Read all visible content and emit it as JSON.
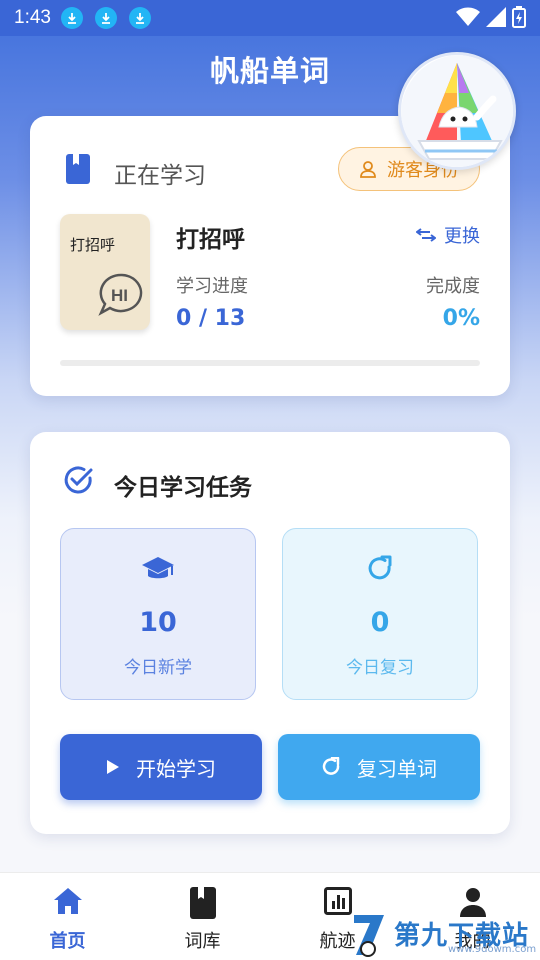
{
  "status_bar": {
    "time": "1:43"
  },
  "header": {
    "app_title": "帆船单词"
  },
  "current_book": {
    "section_title": "正在学习",
    "guest_badge": "游客身份",
    "cover_label": "打招呼",
    "book_name": "打招呼",
    "switch_label": "更换",
    "progress_label": "学习进度",
    "progress_value": "0 / 13",
    "completion_label": "完成度",
    "completion_value": "0%",
    "progress_fraction": 0
  },
  "daily_task": {
    "title": "今日学习任务",
    "new_count": "10",
    "new_label": "今日新学",
    "review_count": "0",
    "review_label": "今日复习",
    "start_button": "开始学习",
    "review_button": "复习单词"
  },
  "bottom_nav": {
    "items": [
      {
        "label": "首页",
        "icon": "home-icon",
        "active": true
      },
      {
        "label": "词库",
        "icon": "bookmark-book-icon",
        "active": false
      },
      {
        "label": "航迹",
        "icon": "chart-icon",
        "active": false
      },
      {
        "label": "我的",
        "icon": "person-icon",
        "active": false
      }
    ]
  },
  "watermark": {
    "text": "第九下载站",
    "url": "www.9dowm.com"
  },
  "colors": {
    "primary": "#3a66d6",
    "accent": "#35a6e8",
    "guest": "#e08a1c"
  }
}
